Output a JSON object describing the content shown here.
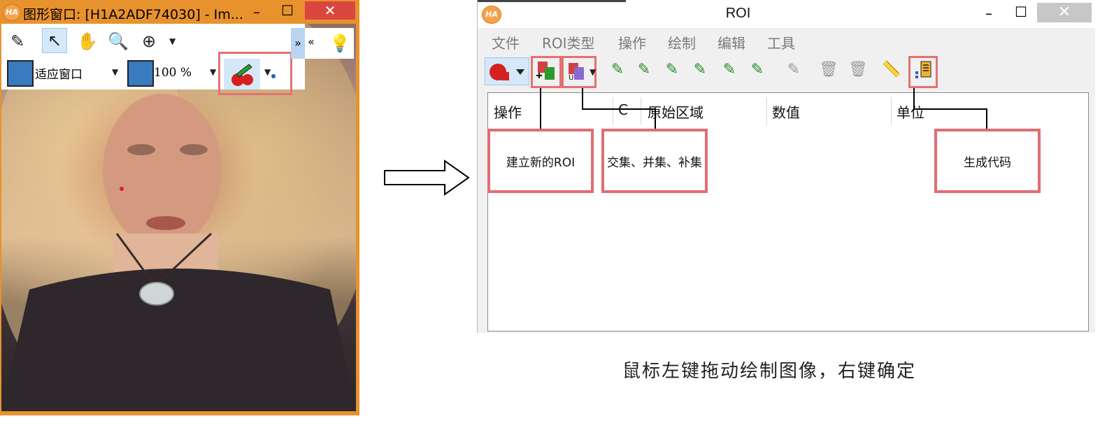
{
  "image_window": {
    "title": "图形窗口: [H1A2ADF74030] - Im...",
    "logo": "HA",
    "minimize": "–",
    "maximize": "☐",
    "close": "✕",
    "fit_label": "适应窗口",
    "zoom_label": "100 %"
  },
  "roi_window": {
    "title": "ROI",
    "logo": "HA",
    "minimize": "–",
    "maximize": "☐",
    "close": "✕",
    "menu": [
      "文件",
      "ROI类型",
      "操作",
      "绘制",
      "编辑",
      "工具"
    ],
    "columns": [
      "操作",
      "C",
      "原始区域",
      "数值",
      "单位"
    ]
  },
  "callouts": {
    "new_roi": "建立新的ROI",
    "set_ops": "交集、并集、补集",
    "gen_code": "生成代码"
  },
  "caption": "鼠标左键拖动绘制图像，右键确定",
  "colors": {
    "window_border": "#e8922e",
    "callout_border": "#e06e72",
    "close_red": "#d9473f"
  }
}
